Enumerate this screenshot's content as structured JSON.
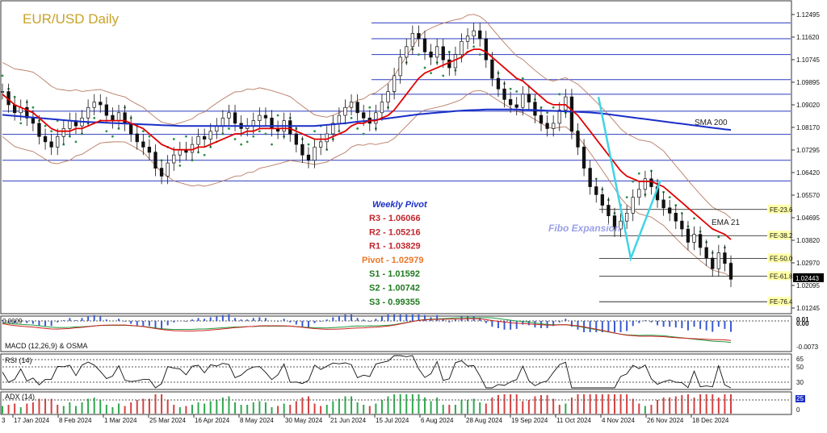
{
  "chart_data": {
    "type": "line",
    "title": "EUR/USD  Daily",
    "price_axis": {
      "ylim": [
        1.0125,
        1.1272
      ],
      "ticks": [
        "1.12495",
        "1.11620",
        "1.10745",
        "1.09895",
        "1.09020",
        "1.08170",
        "1.07295",
        "1.06420",
        "1.05570",
        "1.04695",
        "1.03820",
        "1.02970",
        "1.02095",
        "1.01245"
      ],
      "last_price": "1.02443"
    },
    "x_axis": {
      "labels": [
        "17 Jan 2024",
        "8 Feb 2024",
        "1 Mar 2024",
        "25 Mar 2024",
        "16 Apr 2024",
        "8 May 2024",
        "30 May 2024",
        "21 Jun 2024",
        "15 Jul 2024",
        "6 Aug 2024",
        "28 Aug 2024",
        "19 Sep 2024",
        "11 Oct 2024",
        "4 Nov 2024",
        "26 Nov 2024",
        "18 Dec 2024"
      ],
      "left_edge_label": "3"
    },
    "horizontal_levels": [
      1.121,
      1.115,
      1.109,
      1.0995,
      1.094,
      1.0876,
      1.0788,
      1.069,
      1.0612
    ],
    "series": [
      {
        "name": "Price",
        "color": "#000000",
        "values": [
          1.095,
          1.09,
          1.087,
          1.089,
          1.085,
          1.083,
          1.078,
          1.076,
          1.074,
          1.078,
          1.081,
          1.084,
          1.082,
          1.085,
          1.089,
          1.091,
          1.09,
          1.086,
          1.084,
          1.087,
          1.083,
          1.079,
          1.076,
          1.074,
          1.072,
          1.066,
          1.063,
          1.068,
          1.071,
          1.073,
          1.072,
          1.075,
          1.078,
          1.077,
          1.08,
          1.082,
          1.085,
          1.087,
          1.083,
          1.081,
          1.082,
          1.084,
          1.086,
          1.085,
          1.081,
          1.08,
          1.084,
          1.079,
          1.075,
          1.071,
          1.069,
          1.074,
          1.076,
          1.079,
          1.083,
          1.086,
          1.089,
          1.091,
          1.087,
          1.085,
          1.083,
          1.087,
          1.091,
          1.095,
          1.101,
          1.108,
          1.112,
          1.117,
          1.115,
          1.11,
          1.108,
          1.112,
          1.107,
          1.104,
          1.109,
          1.114,
          1.116,
          1.118,
          1.115,
          1.107,
          1.1,
          1.096,
          1.092,
          1.09,
          1.089,
          1.094,
          1.091,
          1.086,
          1.083,
          1.081,
          1.083,
          1.088,
          1.093,
          1.08,
          1.074,
          1.066,
          1.059,
          1.056,
          1.052,
          1.048,
          1.043,
          1.046,
          1.049,
          1.055,
          1.058,
          1.062,
          1.059,
          1.054,
          1.051,
          1.049,
          1.046,
          1.043,
          1.038,
          1.041,
          1.036,
          1.032,
          1.028,
          1.034,
          1.03,
          1.024
        ]
      },
      {
        "name": "EMA 21",
        "color": "#e00000",
        "values": [
          1.094,
          1.092,
          1.09,
          1.089,
          1.088,
          1.087,
          1.085,
          1.083,
          1.081,
          1.08,
          1.08,
          1.08,
          1.081,
          1.081,
          1.082,
          1.083,
          1.084,
          1.084,
          1.084,
          1.084,
          1.084,
          1.083,
          1.082,
          1.081,
          1.079,
          1.077,
          1.075,
          1.074,
          1.073,
          1.073,
          1.073,
          1.073,
          1.074,
          1.074,
          1.075,
          1.076,
          1.077,
          1.078,
          1.079,
          1.079,
          1.08,
          1.08,
          1.081,
          1.081,
          1.081,
          1.081,
          1.081,
          1.081,
          1.08,
          1.079,
          1.078,
          1.077,
          1.077,
          1.077,
          1.078,
          1.079,
          1.08,
          1.082,
          1.083,
          1.083,
          1.084,
          1.084,
          1.085,
          1.086,
          1.088,
          1.091,
          1.094,
          1.097,
          1.1,
          1.102,
          1.103,
          1.104,
          1.105,
          1.106,
          1.107,
          1.108,
          1.11,
          1.111,
          1.111,
          1.11,
          1.108,
          1.106,
          1.104,
          1.102,
          1.1,
          1.099,
          1.097,
          1.095,
          1.093,
          1.091,
          1.09,
          1.09,
          1.09,
          1.088,
          1.086,
          1.083,
          1.08,
          1.077,
          1.074,
          1.071,
          1.068,
          1.065,
          1.063,
          1.062,
          1.061,
          1.061,
          1.061,
          1.06,
          1.059,
          1.057,
          1.055,
          1.053,
          1.051,
          1.049,
          1.047,
          1.045,
          1.043,
          1.042,
          1.041,
          1.039
        ]
      },
      {
        "name": "SMA 200",
        "color": "#1a2fc8",
        "values": [
          1.0862,
          1.086,
          1.0858,
          1.0856,
          1.0854,
          1.0852,
          1.085,
          1.0848,
          1.0846,
          1.0844,
          1.0842,
          1.084,
          1.0838,
          1.0836,
          1.0835,
          1.0834,
          1.0833,
          1.0832,
          1.0831,
          1.083,
          1.0829,
          1.0828,
          1.0827,
          1.0826,
          1.0825,
          1.0824,
          1.0823,
          1.0822,
          1.0821,
          1.082,
          1.082,
          1.082,
          1.082,
          1.082,
          1.082,
          1.082,
          1.082,
          1.082,
          1.082,
          1.082,
          1.082,
          1.082,
          1.082,
          1.082,
          1.082,
          1.082,
          1.082,
          1.082,
          1.082,
          1.082,
          1.082,
          1.082,
          1.0822,
          1.0824,
          1.0826,
          1.0828,
          1.083,
          1.0833,
          1.0836,
          1.0838,
          1.084,
          1.0843,
          1.0846,
          1.0849,
          1.0852,
          1.0855,
          1.0858,
          1.0861,
          1.0864,
          1.0866,
          1.0868,
          1.087,
          1.0872,
          1.0874,
          1.0876,
          1.0878,
          1.0879,
          1.088,
          1.0881,
          1.0882,
          1.0882,
          1.0882,
          1.0882,
          1.0882,
          1.0882,
          1.0881,
          1.0881,
          1.088,
          1.0879,
          1.0878,
          1.0877,
          1.0876,
          1.0875,
          1.0874,
          1.0873,
          1.0872,
          1.0871,
          1.0869,
          1.0867,
          1.0864,
          1.0861,
          1.0858,
          1.0855,
          1.0852,
          1.0849,
          1.0846,
          1.0843,
          1.084,
          1.0837,
          1.0834,
          1.0831,
          1.0828,
          1.0825,
          1.0822,
          1.0819,
          1.0816,
          1.0813,
          1.081,
          1.0807,
          1.0805
        ]
      }
    ],
    "annotations": {
      "sma200_label": "SMA 200",
      "ema21_label": "EMA 21",
      "fibo_label": "Fibo Expansion"
    },
    "fibo_levels": [
      {
        "label": "FE-23.6",
        "price": 1.0504
      },
      {
        "label": "FE-38.2",
        "price": 1.0405
      },
      {
        "label": "FE-50.0",
        "price": 1.0319
      },
      {
        "label": "FE-61.8",
        "price": 1.0252
      },
      {
        "label": "FE-76.4",
        "price": 1.0155
      }
    ],
    "weekly_pivot": {
      "title": "Weekly Pivot",
      "rows": [
        {
          "name": "R3",
          "value": "1.06066",
          "color": "#c0272d"
        },
        {
          "name": "R2",
          "value": "1.05216",
          "color": "#c0272d"
        },
        {
          "name": "R1",
          "value": "1.03829",
          "color": "#c0272d"
        },
        {
          "name": "Pivot",
          "value": "1.02979",
          "color": "#e9772a"
        },
        {
          "name": "S1",
          "value": "1.01592",
          "color": "#1f7a1f"
        },
        {
          "name": "S2",
          "value": "1.00742",
          "color": "#1f7a1f"
        },
        {
          "name": "S3",
          "value": "0.99355",
          "color": "#1f7a1f"
        }
      ]
    },
    "indicators": [
      {
        "name": "MACD (12,26,9) & OSMA",
        "axis_labels": [
          "0.01",
          "0.00",
          "-0.0073"
        ],
        "left_label": "0.0009"
      },
      {
        "name": "RSI (14)",
        "axis_labels": [
          "65",
          "50",
          "30"
        ]
      },
      {
        "name": "ADX (14)",
        "axis_labels": [
          "25",
          "0"
        ]
      }
    ],
    "colors": {
      "title": "#c9a227",
      "ema": "#e00000",
      "sma": "#1a2fc8",
      "fibo_zigzag": "#3fd4e6",
      "bollinger": "#b77b63",
      "parabolic_sar": "#2f8f4a",
      "level_lines": "#2b3bbf",
      "fibo_box": "#ffffa8"
    }
  }
}
